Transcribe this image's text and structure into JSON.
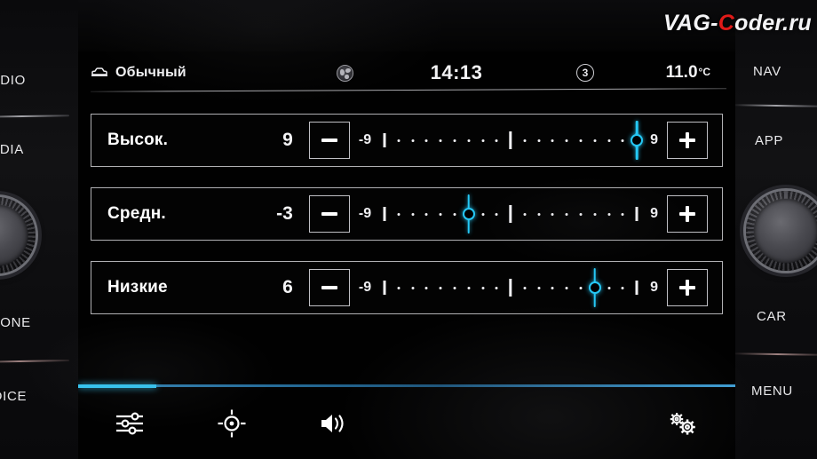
{
  "watermark": {
    "prefix": "VAG-",
    "accent": "C",
    "suffix": "oder.ru",
    "full": "VAG-Coder.ru"
  },
  "colors": {
    "accent": "#25c8f5",
    "accent_line": "#35c6f2",
    "watermark_red": "#e01a18",
    "text": "#ffffff"
  },
  "status_bar": {
    "mode_icon": "car-icon",
    "mode_label": "Обычный",
    "globe_icon": "globe-icon",
    "time": "14:13",
    "gear_icon": "circled-3-icon",
    "gear_value": "3",
    "temperature": "11.0",
    "temperature_unit": "°C"
  },
  "equalizer": {
    "scale_min_label": "-9",
    "scale_max_label": "9",
    "scale_min": -9,
    "scale_max": 9,
    "minus_label": "−",
    "plus_label": "+",
    "rows": [
      {
        "label": "Высок.",
        "value": "9",
        "position": 9
      },
      {
        "label": "Средн.",
        "value": "-3",
        "position": -3
      },
      {
        "label": "Низкие",
        "value": "6",
        "position": 6
      }
    ]
  },
  "bottom_bar": {
    "items": [
      {
        "icon": "equalizer-sliders-icon",
        "name": "equalizer"
      },
      {
        "icon": "balance-fader-crosshair-icon",
        "name": "balance"
      },
      {
        "icon": "volume-speaker-icon",
        "name": "volume"
      }
    ],
    "settings": {
      "icon": "settings-gears-icon",
      "name": "settings"
    }
  },
  "hardware": {
    "left_buttons": [
      {
        "label": "RADIO"
      },
      {
        "label": "MEDIA"
      },
      {
        "label": "PHONE"
      },
      {
        "label": "VOICE"
      }
    ],
    "left_knob": "volume-knob",
    "right_buttons": [
      {
        "label": "NAV"
      },
      {
        "label": "APP"
      },
      {
        "label": "CAR"
      },
      {
        "label": "MENU"
      }
    ],
    "right_knob": "tune-knob"
  }
}
